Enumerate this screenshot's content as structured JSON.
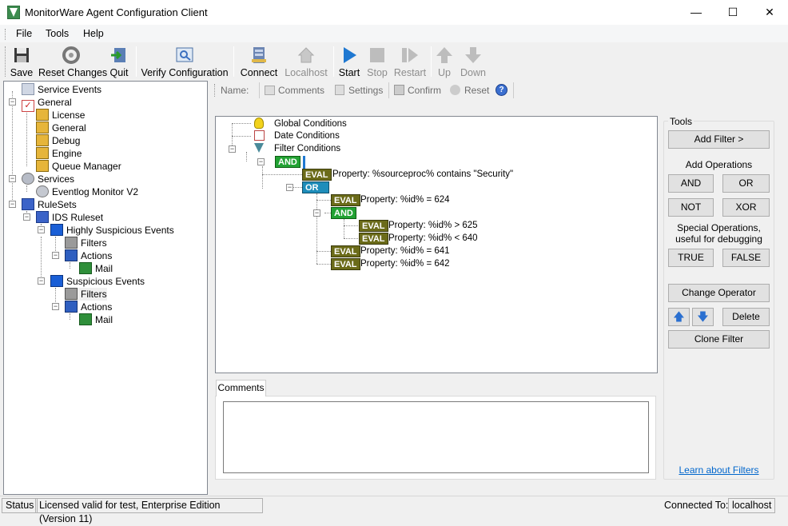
{
  "window": {
    "title": "MonitorWare Agent Configuration Client",
    "minimize": "—",
    "maximize": "☐",
    "close": "✕"
  },
  "menu": [
    "File",
    "Tools",
    "Help"
  ],
  "toolbar": {
    "save": "Save",
    "reset_changes": "Reset Changes",
    "quit": "Quit",
    "verify": "Verify Configuration",
    "connect": "Connect",
    "localhost": "Localhost",
    "start": "Start",
    "stop": "Stop",
    "restart": "Restart",
    "up": "Up",
    "down": "Down"
  },
  "tree": {
    "service_events": "Service Events",
    "general": "General",
    "license": "License",
    "general_child": "General",
    "debug": "Debug",
    "engine": "Engine",
    "queue_manager": "Queue Manager",
    "services": "Services",
    "eventlog_monitor": "Eventlog Monitor V2",
    "rulesets": "RuleSets",
    "ids_ruleset": "IDS Ruleset",
    "highly_suspicious": "Highly Suspicious Events",
    "filters1": "Filters",
    "actions1": "Actions",
    "mail1": "Mail",
    "suspicious": "Suspicious Events",
    "filters2": "Filters",
    "actions2": "Actions",
    "mail2": "Mail"
  },
  "subbar": {
    "name": "Name:",
    "comments": "Comments",
    "settings": "Settings",
    "confirm": "Confirm",
    "reset": "Reset"
  },
  "filter": {
    "global": "Global Conditions",
    "date": "Date Conditions",
    "filter_conditions": "Filter Conditions",
    "and": "AND",
    "or": "OR",
    "eval": "EVAL",
    "p1": "Property: %sourceproc% contains \"Security\"",
    "p2": "Property: %id% = 624",
    "p3": "Property: %id% >  625",
    "p4": "Property: %id% < 640",
    "p5": "Property: %id% = 641",
    "p6": "Property: %id% = 642"
  },
  "comments": {
    "tab": "Comments"
  },
  "tools": {
    "title": "Tools",
    "add_filter": "Add Filter >",
    "add_operations": "Add Operations",
    "and": "AND",
    "or": "OR",
    "not": "NOT",
    "xor": "XOR",
    "special_line1": "Special Operations,",
    "special_line2": "useful for debugging",
    "true": "TRUE",
    "false": "FALSE",
    "change_operator": "Change Operator",
    "delete": "Delete",
    "clone_filter": "Clone Filter",
    "learn": "Learn about Filters",
    "up_arrow": "🡅",
    "down_arrow": "🡇"
  },
  "status": {
    "label": "Status",
    "license": "Licensed valid for test, Enterprise Edition (Version 11)",
    "connected_to": "Connected To:",
    "host": "localhost"
  },
  "colors": {
    "and_badge": "#22a233",
    "eval_badge": "#6b6b19",
    "or_badge": "#1e8dba",
    "link": "#0066cc"
  }
}
